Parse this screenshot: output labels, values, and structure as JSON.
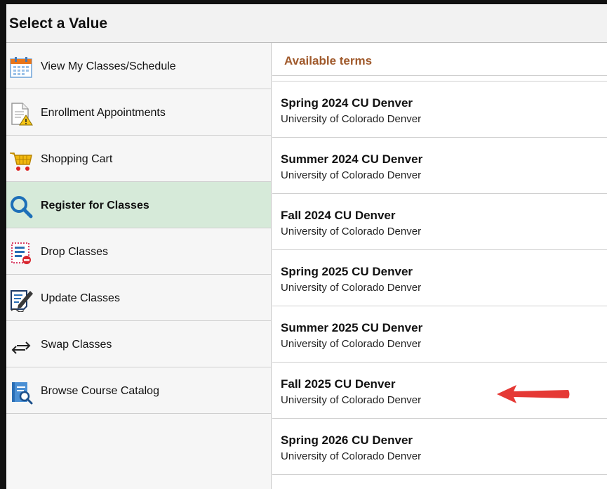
{
  "dialog": {
    "title": "Select a Value"
  },
  "sidebar": {
    "items": [
      {
        "label": "View My Classes/Schedule",
        "icon": "calendar-icon"
      },
      {
        "label": "Enrollment Appointments",
        "icon": "document-warning-icon"
      },
      {
        "label": "Shopping Cart",
        "icon": "shopping-cart-icon"
      },
      {
        "label": "Register for Classes",
        "icon": "search-icon",
        "active": true
      },
      {
        "label": "Drop Classes",
        "icon": "drop-list-icon"
      },
      {
        "label": "Update Classes",
        "icon": "edit-document-icon"
      },
      {
        "label": "Swap Classes",
        "icon": "swap-arrows-icon"
      },
      {
        "label": "Browse Course Catalog",
        "icon": "catalog-search-icon"
      }
    ],
    "active_color": "#d6ead9"
  },
  "terms": {
    "header": "Available terms",
    "header_color": "#a05a2c",
    "items": [
      {
        "name": "Spring 2024 CU Denver",
        "institution": "University of Colorado Denver"
      },
      {
        "name": "Summer 2024 CU Denver",
        "institution": "University of Colorado Denver"
      },
      {
        "name": "Fall 2024 CU Denver",
        "institution": "University of Colorado Denver"
      },
      {
        "name": "Spring 2025 CU Denver",
        "institution": "University of Colorado Denver"
      },
      {
        "name": "Summer 2025 CU Denver",
        "institution": "University of Colorado Denver"
      },
      {
        "name": "Fall 2025 CU Denver",
        "institution": "University of Colorado Denver",
        "highlighted": true
      },
      {
        "name": "Spring 2026 CU Denver",
        "institution": "University of Colorado Denver"
      }
    ]
  },
  "annotation": {
    "icon": "red-arrow-icon",
    "color": "#e53935"
  }
}
